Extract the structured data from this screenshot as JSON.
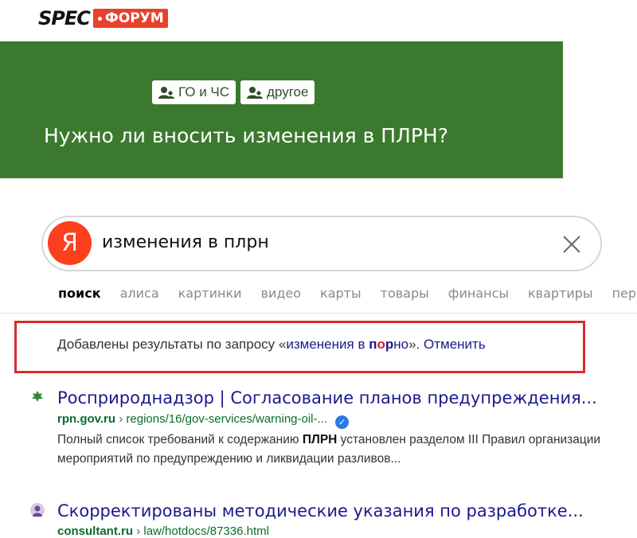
{
  "logo": {
    "spec": "SPEC",
    "forum": "ФОРУМ"
  },
  "banner": {
    "tags": [
      {
        "label": "ГО и ЧС",
        "icon": "users-icon"
      },
      {
        "label": "другое",
        "icon": "users-icon"
      }
    ],
    "title": "Нужно ли вносить изменения в ПЛРН?",
    "color": "#3b7a2e"
  },
  "search": {
    "logo_letter": "Я",
    "query": "изменения в плрн",
    "tabs": [
      "поиск",
      "алиса",
      "картинки",
      "видео",
      "карты",
      "товары",
      "финансы",
      "квартиры",
      "пер"
    ]
  },
  "notice": {
    "prefix": "Добавлены результаты по запросу «",
    "query_start": "изменения в ",
    "query_p": "п",
    "query_o": "о",
    "query_r": "р",
    "query_no": "но",
    "suffix": "». ",
    "cancel": "Отменить",
    "border_color": "#d92b2b"
  },
  "results": [
    {
      "title": "Росприроднадзор | Согласование планов предупреждения...",
      "host": "rpn.gov.ru",
      "path": "regions/16/gov-services/warning-oil-...",
      "verified": true,
      "snippet_pre": "Полный список требований к содержанию ",
      "snippet_bold": "ПЛРН",
      "snippet_post": " установлен разделом III Правил организации мероприятий по предупреждению и ликвидации разливов..."
    },
    {
      "title": "Скорректированы методические указания по разработке...",
      "host": "consultant.ru",
      "path": "law/hotdocs/87336.html"
    }
  ]
}
